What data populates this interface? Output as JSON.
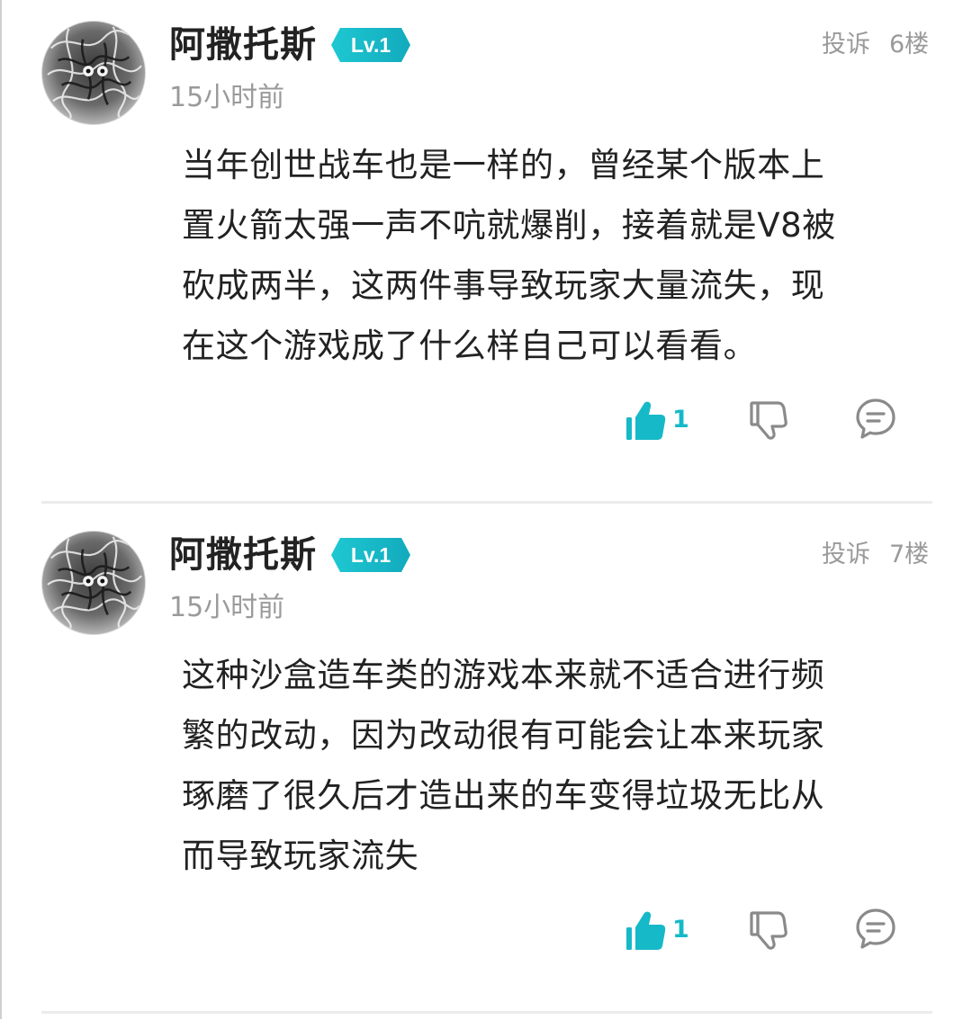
{
  "comments": [
    {
      "username": "阿撒托斯",
      "level": "Lv.1",
      "time": "15小时前",
      "report_label": "投诉",
      "floor": "6楼",
      "body_lines": [
        "当年创世战车也是一样的，曾经某个版本上",
        "置火箭太强一声不吭就爆削，接着就是V8被",
        "砍成两半，这两件事导致玩家大量流失，现",
        "在这个游戏成了什么样自己可以看看。"
      ],
      "likes": "1",
      "icons": {
        "like": "thumbs-up-icon",
        "dislike": "thumbs-down-icon",
        "reply": "comment-bubble-icon"
      }
    },
    {
      "username": "阿撒托斯",
      "level": "Lv.1",
      "time": "15小时前",
      "report_label": "投诉",
      "floor": "7楼",
      "body_lines": [
        "这种沙盒造车类的游戏本来就不适合进行频",
        "繁的改动，因为改动很有可能会让本来玩家",
        "琢磨了很久后才造出来的车变得垃圾无比从",
        "而导致玩家流失"
      ],
      "likes": "1",
      "icons": {
        "like": "thumbs-up-icon",
        "dislike": "thumbs-down-icon",
        "reply": "comment-bubble-icon"
      }
    }
  ],
  "colors": {
    "accent": "#16b9c8",
    "badge_gradient_start": "#1ec8d2",
    "badge_gradient_end": "#12aabd",
    "muted_text": "#9a9a9a",
    "main_text": "#222222",
    "divider": "#ececec"
  }
}
